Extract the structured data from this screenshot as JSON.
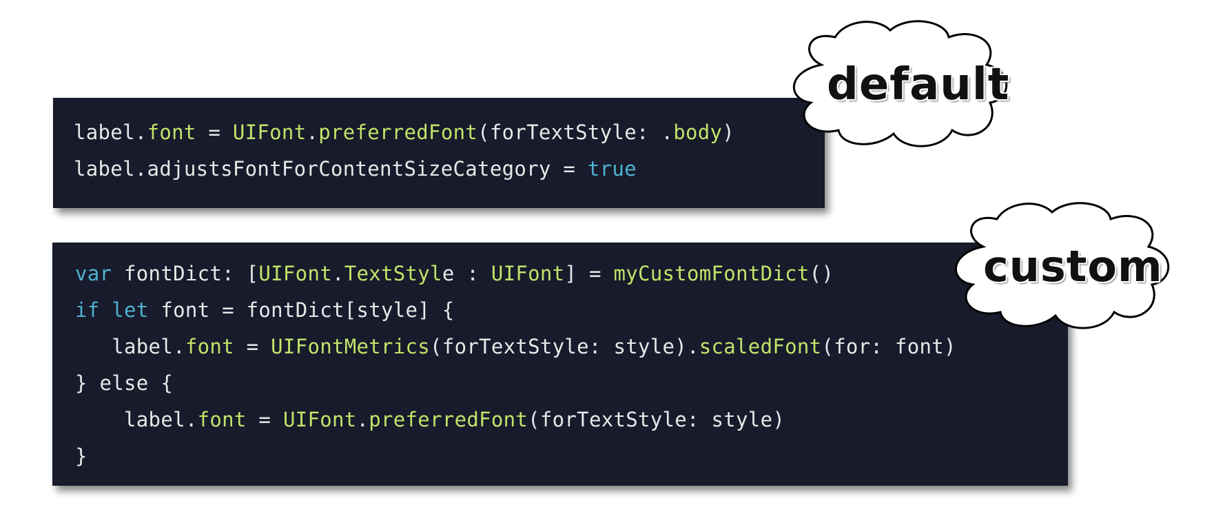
{
  "default_block": {
    "lines": [
      [
        {
          "text": "label.",
          "kind": "plain"
        },
        {
          "text": "font",
          "kind": "green"
        },
        {
          "text": " = ",
          "kind": "plain"
        },
        {
          "text": "UIFont",
          "kind": "green"
        },
        {
          "text": ".",
          "kind": "plain"
        },
        {
          "text": "preferredFont",
          "kind": "green"
        },
        {
          "text": "(forTextStyle: .",
          "kind": "plain"
        },
        {
          "text": "body",
          "kind": "green"
        },
        {
          "text": ")",
          "kind": "plain"
        }
      ],
      [
        {
          "text": "label.adjustsFontForContentSizeCategory = ",
          "kind": "plain"
        },
        {
          "text": "true",
          "kind": "blue"
        }
      ]
    ]
  },
  "custom_block": {
    "lines": [
      [
        {
          "text": "var",
          "kind": "blue"
        },
        {
          "text": " fontDict: [",
          "kind": "plain"
        },
        {
          "text": "UIFont",
          "kind": "green"
        },
        {
          "text": ".",
          "kind": "plain"
        },
        {
          "text": "TextStyl",
          "kind": "green"
        },
        {
          "text": "e : ",
          "kind": "plain"
        },
        {
          "text": "UIFont",
          "kind": "green"
        },
        {
          "text": "] = ",
          "kind": "plain"
        },
        {
          "text": "myCustomFontDict",
          "kind": "green"
        },
        {
          "text": "()",
          "kind": "plain"
        }
      ],
      [
        {
          "text": "if",
          "kind": "blue"
        },
        {
          "text": " ",
          "kind": "plain"
        },
        {
          "text": "let",
          "kind": "blue"
        },
        {
          "text": " font = fontDict[style] {",
          "kind": "plain"
        }
      ],
      [
        {
          "text": "   label.",
          "kind": "plain"
        },
        {
          "text": "font",
          "kind": "green"
        },
        {
          "text": " = ",
          "kind": "plain"
        },
        {
          "text": "UIFontMetrics",
          "kind": "green"
        },
        {
          "text": "(forTextStyle: style).",
          "kind": "plain"
        },
        {
          "text": "scaledFont",
          "kind": "green"
        },
        {
          "text": "(for: font)",
          "kind": "plain"
        }
      ],
      [
        {
          "text": "} else {",
          "kind": "plain"
        }
      ],
      [
        {
          "text": "    label.",
          "kind": "plain"
        },
        {
          "text": "font",
          "kind": "green"
        },
        {
          "text": " = ",
          "kind": "plain"
        },
        {
          "text": "UIFont",
          "kind": "green"
        },
        {
          "text": ".",
          "kind": "plain"
        },
        {
          "text": "preferredFont",
          "kind": "green"
        },
        {
          "text": "(forTextStyle: style)",
          "kind": "plain"
        }
      ],
      [
        {
          "text": "}",
          "kind": "plain"
        }
      ]
    ]
  },
  "callouts": {
    "default_label": "default",
    "custom_label": "custom"
  },
  "colors": {
    "code_background": "#171b2b",
    "plain_text": "#e8e8e8",
    "identifier_green": "#c2e36a",
    "keyword_blue": "#4fb2cf"
  }
}
